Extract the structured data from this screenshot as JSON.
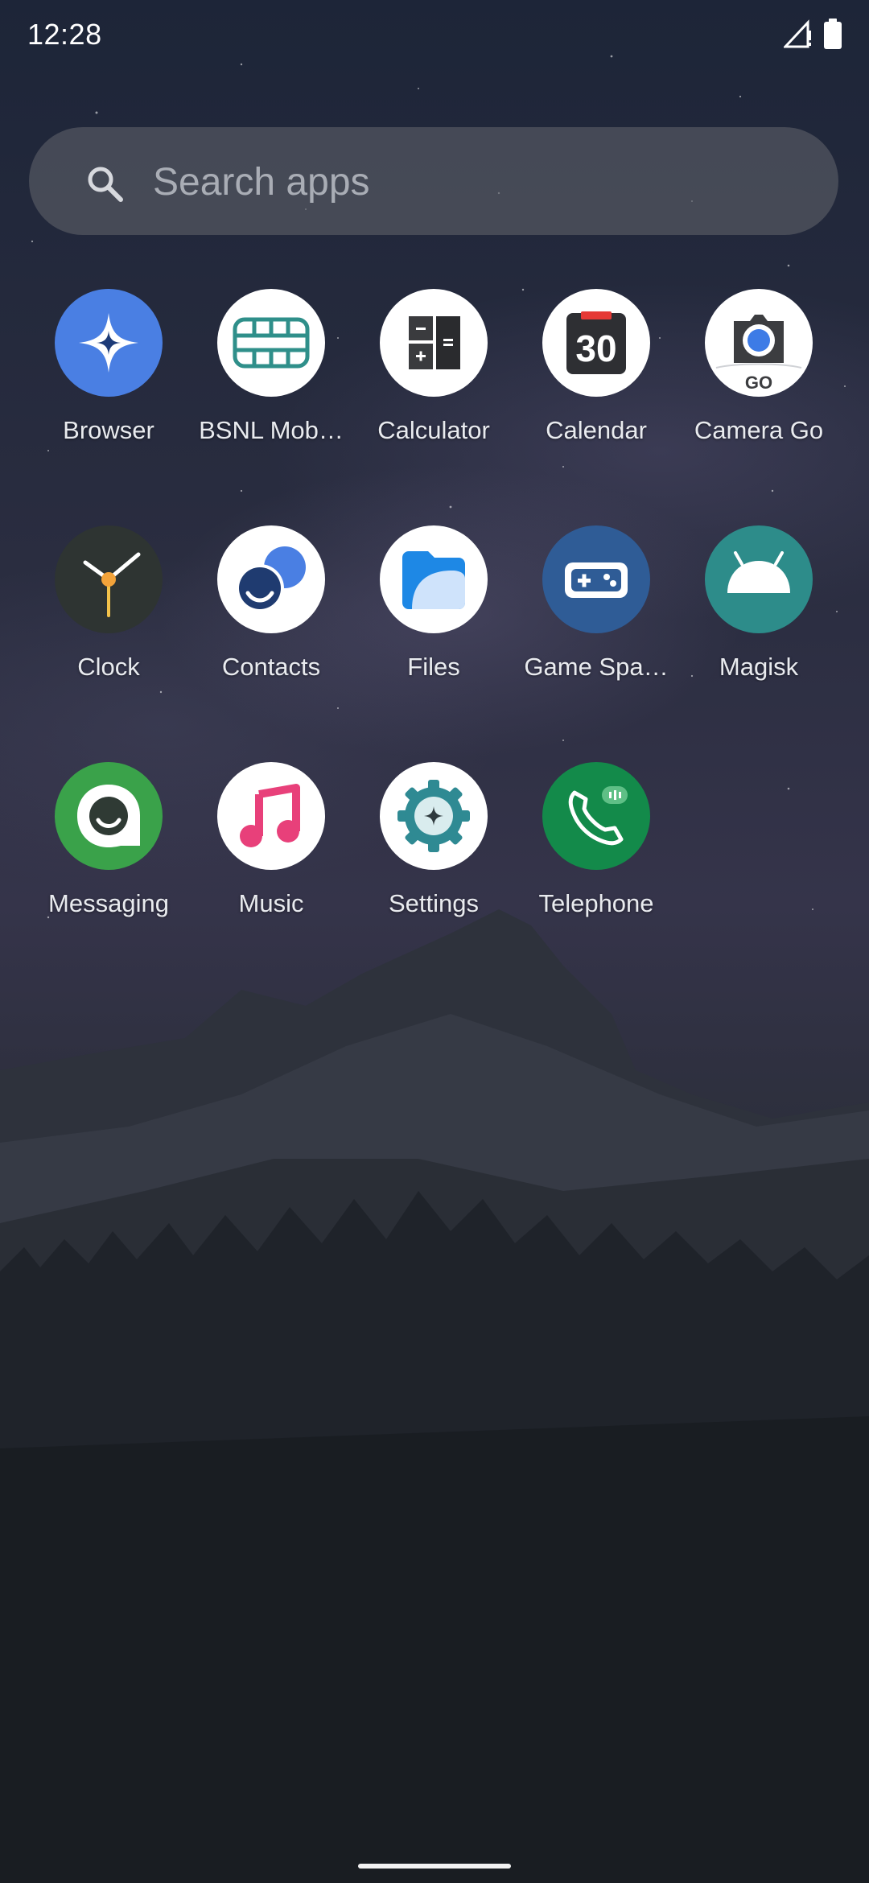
{
  "status_bar": {
    "time": "12:28",
    "icons": [
      "signal-no-service-icon",
      "battery-full-icon"
    ]
  },
  "search": {
    "placeholder": "Search apps",
    "value": "",
    "icon": "search-icon"
  },
  "apps": [
    {
      "label": "Browser",
      "icon": "browser-icon",
      "color": "#4a7fe3"
    },
    {
      "label": "BSNL Mob…",
      "icon": "sim-card-icon",
      "color": "#2f8f8a"
    },
    {
      "label": "Calculator",
      "icon": "calculator-icon",
      "color": "#2f3033"
    },
    {
      "label": "Calendar",
      "icon": "calendar-icon",
      "calendar_day": "30",
      "color": "#e53935"
    },
    {
      "label": "Camera Go",
      "icon": "camera-icon",
      "camera_badge": "GO",
      "color": "#3d7be6"
    },
    {
      "label": "Clock",
      "icon": "clock-icon",
      "color": "#2e3432"
    },
    {
      "label": "Contacts",
      "icon": "contacts-icon",
      "color": "#1f3b70"
    },
    {
      "label": "Files",
      "icon": "folder-icon",
      "color": "#1e88e5"
    },
    {
      "label": "Game Spa…",
      "icon": "gamepad-icon",
      "color": "#2f5c96"
    },
    {
      "label": "Magisk",
      "icon": "android-icon",
      "color": "#2d8c8a"
    },
    {
      "label": "Messaging",
      "icon": "messaging-icon",
      "color": "#3aa24a"
    },
    {
      "label": "Music",
      "icon": "music-note-icon",
      "color": "#e8407a"
    },
    {
      "label": "Settings",
      "icon": "settings-gear-icon",
      "color": "#2f8a93"
    },
    {
      "label": "Telephone",
      "icon": "phone-icon",
      "color": "#138a4a"
    }
  ]
}
